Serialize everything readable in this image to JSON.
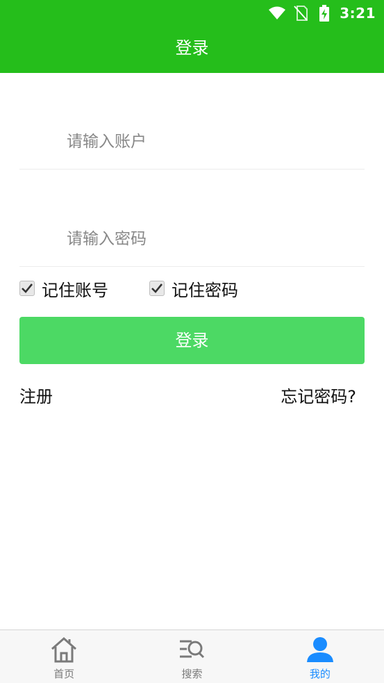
{
  "status": {
    "time": "3:21",
    "icons": [
      "wifi-icon",
      "no-sim-icon",
      "battery-charging-icon"
    ]
  },
  "header": {
    "title": "登录"
  },
  "form": {
    "account_placeholder": "请输入账户",
    "password_placeholder": "请输入密码",
    "remember_account_label": "记住账号",
    "remember_account_checked": true,
    "remember_password_label": "记住密码",
    "remember_password_checked": true,
    "login_label": "登录",
    "register_label": "注册",
    "forgot_label": "忘记密码?"
  },
  "tabs": [
    {
      "label": "首页",
      "icon": "home-icon",
      "active": false
    },
    {
      "label": "搜索",
      "icon": "search-icon",
      "active": false
    },
    {
      "label": "我的",
      "icon": "user-icon",
      "active": true
    }
  ],
  "colors": {
    "header": "#25be1b",
    "button": "#4cd964",
    "active_tab": "#1a8cff"
  }
}
